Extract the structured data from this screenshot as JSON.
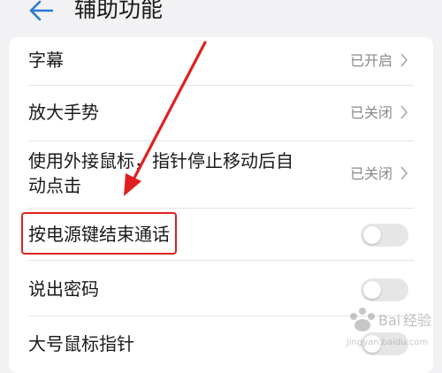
{
  "header": {
    "title": "辅助功能",
    "back_icon": "back-arrow-icon"
  },
  "settings": [
    {
      "label": "字幕",
      "value": "已开启",
      "control": "chevron"
    },
    {
      "label": "放大手势",
      "value": "已关闭",
      "control": "chevron"
    },
    {
      "label_line1": "使用外接鼠标，指针停止移动后自",
      "label_line2": "动点击",
      "value": "已关闭",
      "control": "chevron"
    },
    {
      "label": "按电源键结束通话",
      "control": "toggle",
      "checked": false
    },
    {
      "label": "说出密码",
      "control": "toggle",
      "checked": false
    },
    {
      "label": "大号鼠标指针",
      "control": "toggle",
      "checked": false
    }
  ],
  "annotation": {
    "arrow_color": "#e02020",
    "highlight_color": "#e02020"
  },
  "watermark": {
    "text": "Baidu经验",
    "sub": "jingyan.baidu.com"
  },
  "colors": {
    "accent": "#1a73e8",
    "background": "#f2f2f4",
    "card": "#ffffff"
  }
}
